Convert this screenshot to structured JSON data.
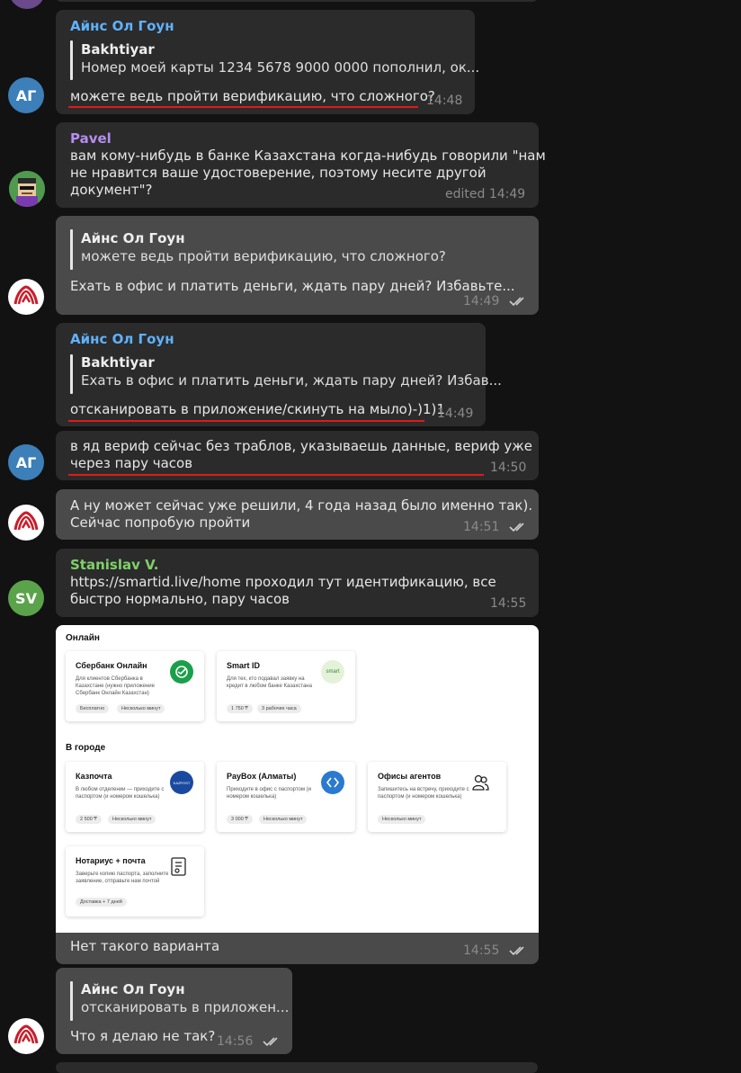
{
  "messages": {
    "m1": {
      "sender": "Айнс Ол Гоун",
      "quote_author": "Bakhtiyar",
      "quote_text": "Номер моей карты 1234 5678 9000 0000 пополнил, ок...",
      "text": "можете ведь пройти верификацию, что сложного?",
      "time": "14:48",
      "avatar": "АГ"
    },
    "m2": {
      "sender": "Pavel",
      "lines": [
        "вам кому-нибудь в банке Казахстана когда-нибудь говорили \"нам",
        "не нравится ваше удостоверение, поэтому несите другой",
        "документ\"?"
      ],
      "time": "edited 14:49"
    },
    "m3": {
      "quote_author": "Айнс Ол Гоун",
      "quote_text": "можете ведь пройти верификацию, что сложного?",
      "text": "Ехать в офис и платить деньги, ждать пару дней? Избавьте...",
      "time": "14:49"
    },
    "m4": {
      "sender": "Айнс Ол Гоун",
      "quote_author": "Bakhtiyar",
      "quote_text": "Ехать в офис и платить деньги, ждать пару дней? Избав...",
      "text": "отсканировать в приложение/скинуть на мыло)-)1)1",
      "time": "14:49"
    },
    "m5": {
      "lines": [
        "в яд вериф сейчас без траблов, указываешь данные, вериф уже",
        "через пару часов"
      ],
      "time": "14:50",
      "avatar": "АГ"
    },
    "m6": {
      "lines": [
        "А ну может сейчас уже решили, 4 года назад было именно так).",
        "Сейчас попробую пройти"
      ],
      "time": "14:51"
    },
    "m7": {
      "sender": "Stanislav V.",
      "lines": [
        "https://smartid.live/home проходил тут идентификацию, все",
        "быстро нормально, пару часов"
      ],
      "time": "14:55",
      "avatar": "SV"
    },
    "m8": {
      "caption": "Нет такого варианта",
      "time": "14:55",
      "image": {
        "section_online": "Онлайн",
        "section_city": "В городе",
        "cards": [
          {
            "title": "Сбербанк Онлайн",
            "desc": "Для клиентов Сбербанка в Казахстане (нужно приложение Сбербанк Онлайн Казахстан)",
            "chips": [
              "Бесплатно",
              "Несколько минут"
            ],
            "logo": "sber-logo-icon"
          },
          {
            "title": "Smart ID",
            "desc": "Для тех, кто подавал заявку на кредит в любом банке Казахстана",
            "chips": [
              "1 750 ₸",
              "3 рабочих часа"
            ],
            "logo": "smart-logo-icon",
            "logo_text": "smart"
          },
          {
            "title": "Казпочта",
            "desc": "В любом отделении — приходите с паспортом (и номером кошелька)",
            "chips": [
              "2 500 ₸",
              "Несколько минут"
            ],
            "logo": "kazpost-logo-icon",
            "logo_text": "KAZPOST"
          },
          {
            "title": "PayBox (Алматы)",
            "desc": "Приходите в офис с паспортом (и номером кошелька)",
            "chips": [
              "3 000 ₸",
              "Несколько минут"
            ],
            "logo": "paybox-logo-icon"
          },
          {
            "title": "Офисы агентов",
            "desc": "Запишитесь на встречу, приходите с паспортом (и номером кошелька)",
            "chips": [
              "Несколько минут"
            ],
            "logo": "people-icon"
          },
          {
            "title": "Нотариус + почта",
            "desc": "Заверьте копию паспорта, заполните заявление, отправьте нам почтой",
            "chips": [
              "Доставка + 7 дней"
            ],
            "logo": "document-icon"
          }
        ]
      }
    },
    "m9": {
      "quote_author": "Айнс Ол Гоун",
      "quote_text": "отсканировать в приложен...",
      "text": "Что я делаю не так?",
      "time": "14:56"
    }
  },
  "colors": {
    "background": "#121212",
    "bubble_in": "#2b2b2b",
    "bubble_out": "#4a4a4a",
    "name_blue": "#5fb2ff",
    "name_purple": "#b58df0",
    "name_green": "#7fd06a",
    "annotation_red": "#e01a1a"
  }
}
